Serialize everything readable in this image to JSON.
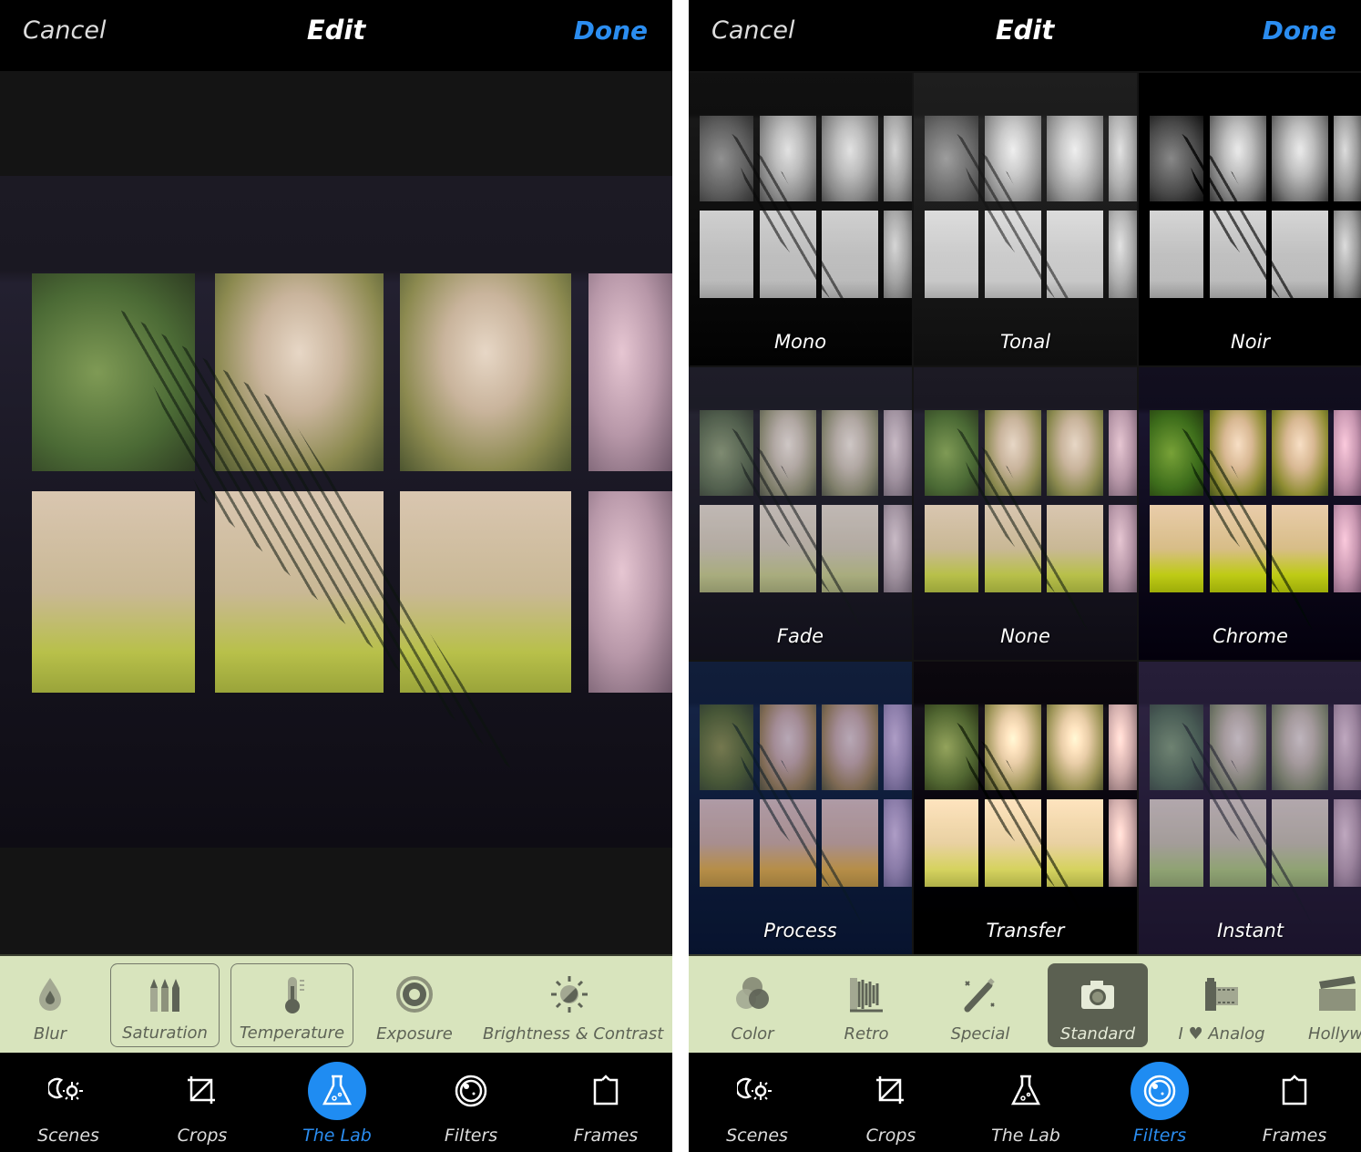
{
  "colors": {
    "accent": "#2b8df0",
    "toolbar_bg": "#d8e4bd",
    "selected_tool_bg": "#5b6051"
  },
  "left": {
    "header": {
      "cancel": "Cancel",
      "title": "Edit",
      "done": "Done"
    },
    "tools": [
      {
        "label": "Blur",
        "icon": "droplet-icon",
        "state": "normal"
      },
      {
        "label": "Saturation",
        "icon": "pencils-icon",
        "state": "framed"
      },
      {
        "label": "Temperature",
        "icon": "thermometer-icon",
        "state": "framed"
      },
      {
        "label": "Exposure",
        "icon": "aperture-icon",
        "state": "normal"
      },
      {
        "label": "Brightness & Contrast",
        "icon": "sun-contrast-icon",
        "state": "normal"
      }
    ],
    "nav": [
      {
        "label": "Scenes",
        "icon": "moon-sun-icon"
      },
      {
        "label": "Crops",
        "icon": "crop-icon"
      },
      {
        "label": "The Lab",
        "icon": "flask-icon",
        "active": true
      },
      {
        "label": "Filters",
        "icon": "lens-icon"
      },
      {
        "label": "Frames",
        "icon": "frame-icon"
      }
    ]
  },
  "right": {
    "header": {
      "cancel": "Cancel",
      "title": "Edit",
      "done": "Done"
    },
    "filters": [
      "Mono",
      "Tonal",
      "Noir",
      "Fade",
      "None",
      "Chrome",
      "Process",
      "Transfer",
      "Instant"
    ],
    "tools": [
      {
        "label": "Color",
        "icon": "color-circles-icon",
        "state": "normal"
      },
      {
        "label": "Retro",
        "icon": "bellows-camera-icon",
        "state": "normal"
      },
      {
        "label": "Special",
        "icon": "magic-wand-icon",
        "state": "normal"
      },
      {
        "label": "Standard",
        "icon": "camera-icon",
        "state": "selected"
      },
      {
        "label": "I ♥ Analog",
        "icon": "film-roll-icon",
        "state": "normal"
      },
      {
        "label": "Hollyw",
        "icon": "clapperboard-icon",
        "state": "normal"
      }
    ],
    "nav": [
      {
        "label": "Scenes",
        "icon": "moon-sun-icon"
      },
      {
        "label": "Crops",
        "icon": "crop-icon"
      },
      {
        "label": "The Lab",
        "icon": "flask-icon"
      },
      {
        "label": "Filters",
        "icon": "lens-icon",
        "active": true
      },
      {
        "label": "Frames",
        "icon": "frame-icon"
      }
    ]
  }
}
